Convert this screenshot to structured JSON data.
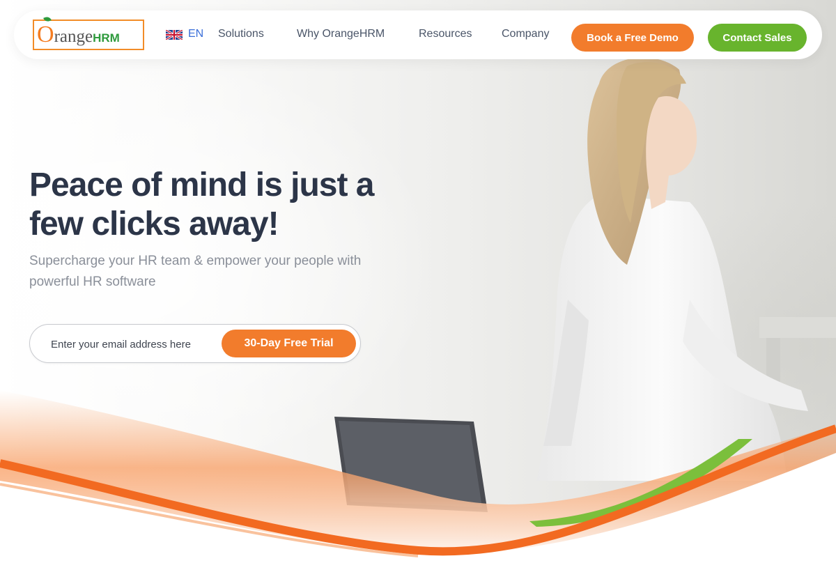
{
  "brand": {
    "logo_o": "O",
    "logo_rest": "range",
    "logo_hrm": "HRM",
    "colors": {
      "orange": "#f27c2c",
      "green": "#68b42d",
      "navy": "#2c3548"
    }
  },
  "header": {
    "language": {
      "flag": "uk-flag-icon",
      "code": "EN"
    },
    "nav": [
      "Solutions",
      "Why OrangeHRM",
      "Resources",
      "Company"
    ],
    "book_demo_label": "Book a Free Demo",
    "contact_sales_label": "Contact Sales"
  },
  "hero": {
    "title": "Peace of mind is just a few clicks away!",
    "subtitle": "Supercharge your HR team & empower your people with powerful HR software",
    "email_placeholder": "Enter your email address here",
    "trial_button_label": "30-Day Free Trial"
  }
}
